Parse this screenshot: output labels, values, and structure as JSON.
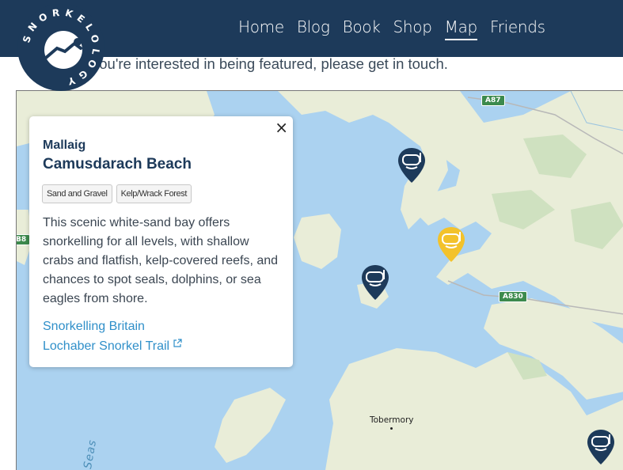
{
  "logo": {
    "text": "SNORKELOLOGY"
  },
  "nav": {
    "items": [
      {
        "label": "Home"
      },
      {
        "label": "Blog"
      },
      {
        "label": "Book"
      },
      {
        "label": "Shop"
      },
      {
        "label": "Map"
      },
      {
        "label": "Friends"
      }
    ],
    "active": "Map"
  },
  "intro": {
    "text": "you're interested in being featured, please get in touch."
  },
  "popup": {
    "close_label": "×",
    "region": "Mallaig",
    "title": "Camusdarach Beach",
    "tags": [
      "Sand and Gravel",
      "Kelp/Wrack Forest"
    ],
    "description": "This scenic white-sand bay offers snorkelling for all levels, with shallow crabs and flatfish, kelp-covered reefs, and chances to spot seals, dolphins, or sea eagles from shore.",
    "links": [
      {
        "label": "Snorkelling Britain",
        "external": false
      },
      {
        "label": "Lochaber Snorkel Trail",
        "external": true
      }
    ]
  },
  "map": {
    "roads": [
      "A87",
      "A830",
      "B8"
    ],
    "places": [
      "Tobermory"
    ],
    "sea_label": "Seas",
    "markers": [
      {
        "color": "#1d3a5a",
        "icon": "snorkel-mask-icon"
      },
      {
        "color": "#f3c22b",
        "icon": "snorkel-mask-icon"
      },
      {
        "color": "#1d3a5a",
        "icon": "snorkel-mask-icon"
      },
      {
        "color": "#1d3a5a",
        "icon": "snorkel-mask-icon"
      }
    ],
    "colors": {
      "water": "#abd2f0",
      "land": "#e9edd8",
      "forest": "#cfe1c0"
    }
  }
}
